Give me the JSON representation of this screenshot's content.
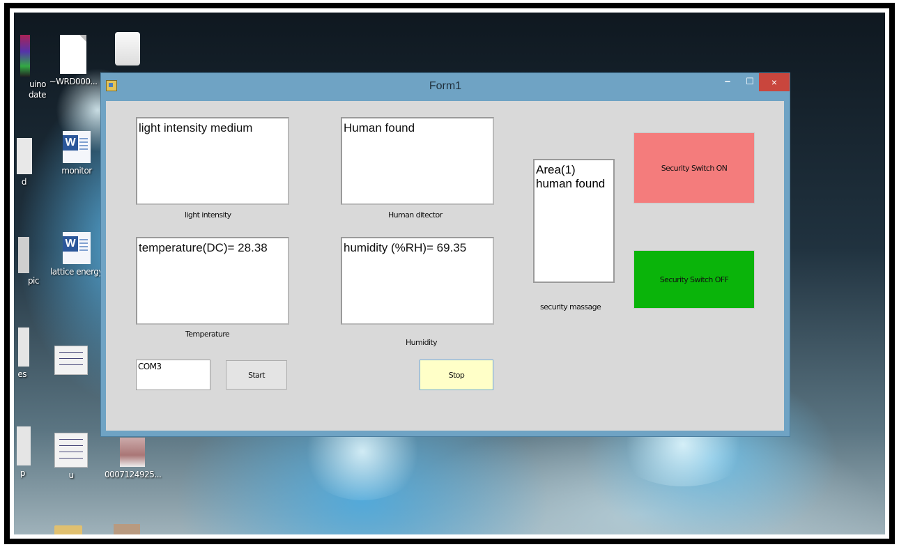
{
  "desktop": {
    "icons": [
      {
        "label": "uino\ndate",
        "icon": "app-icon"
      },
      {
        "label": "~WRD000...",
        "icon": "document-icon"
      },
      {
        "label": "",
        "icon": "bulb-image-icon"
      },
      {
        "label": "d",
        "icon": "partial-icon"
      },
      {
        "label": "monitor",
        "icon": "word-document-icon"
      },
      {
        "label": "pic",
        "icon": "partial-icon"
      },
      {
        "label": "lattice energy",
        "icon": "word-document-icon"
      },
      {
        "label": "es",
        "icon": "partial-icon"
      },
      {
        "label": "",
        "icon": "circuit-image-icon"
      },
      {
        "label": "p",
        "icon": "partial-icon"
      },
      {
        "label": "u",
        "icon": "circuit-image-icon"
      },
      {
        "label": "0007124925...",
        "icon": "photo-icon"
      }
    ]
  },
  "window": {
    "title": "Form1",
    "controls": {
      "minimize": "–",
      "maximize": "☐",
      "close": "×"
    },
    "colors": {
      "titlebar": "#6fa3c4",
      "client": "#d9d9d9",
      "close": "#c9463d"
    }
  },
  "form": {
    "light": {
      "value": "light intensity medium",
      "caption": "light intensity"
    },
    "human": {
      "value": "Human found",
      "caption": "Human ditector"
    },
    "temperature": {
      "value": "temperature(DC)= 28.38",
      "caption": "Temperature"
    },
    "humidity": {
      "value": "humidity (%RH)= 69.35",
      "caption": "Humidity"
    },
    "security": {
      "lines": [
        "Area(1)",
        "human found"
      ],
      "caption": "security massage"
    },
    "port": {
      "value": "COM3"
    },
    "start_label": "Start",
    "stop_label": "Stop",
    "security_on_label": "Security Switch ON",
    "security_off_label": "Security Switch OFF",
    "colors": {
      "security_on": "#f47c7c",
      "security_off": "#0ab40a",
      "stop": "#ffffc8"
    }
  }
}
